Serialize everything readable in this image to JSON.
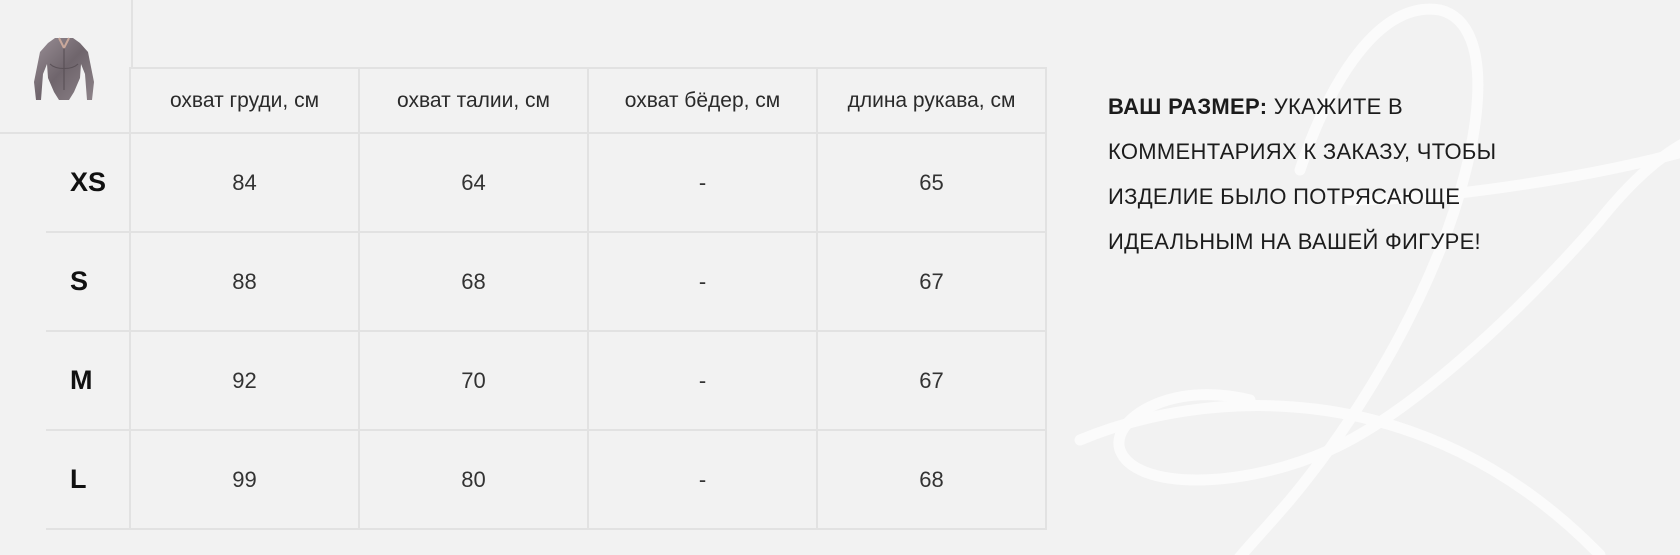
{
  "table": {
    "headers": [
      "охват груди, см",
      "охват талии, см",
      "охват бёдер, см",
      "длина рукава, см"
    ],
    "rows": [
      {
        "size": "XS",
        "values": [
          "84",
          "64",
          "-",
          "65"
        ]
      },
      {
        "size": "S",
        "values": [
          "88",
          "68",
          "-",
          "67"
        ]
      },
      {
        "size": "M",
        "values": [
          "92",
          "70",
          "-",
          "67"
        ]
      },
      {
        "size": "L",
        "values": [
          "99",
          "80",
          "-",
          "68"
        ]
      }
    ]
  },
  "note": {
    "label": "ВАШ РАЗМЕР:",
    "text": " УКАЖИТЕ В КОММЕНТАРИЯХ К ЗАКАЗУ, ЧТОБЫ ИЗДЕЛИЕ БЫЛО ПОТРЯСАЮЩЕ ИДЕАЛЬНЫМ НА ВАШЕЙ ФИГУРЕ!"
  },
  "product_image": {
    "icon": "bodysuit-image"
  },
  "colors": {
    "background": "#f2f2f2",
    "grid": "#e2e2e2",
    "decoration": "#fafafa"
  }
}
